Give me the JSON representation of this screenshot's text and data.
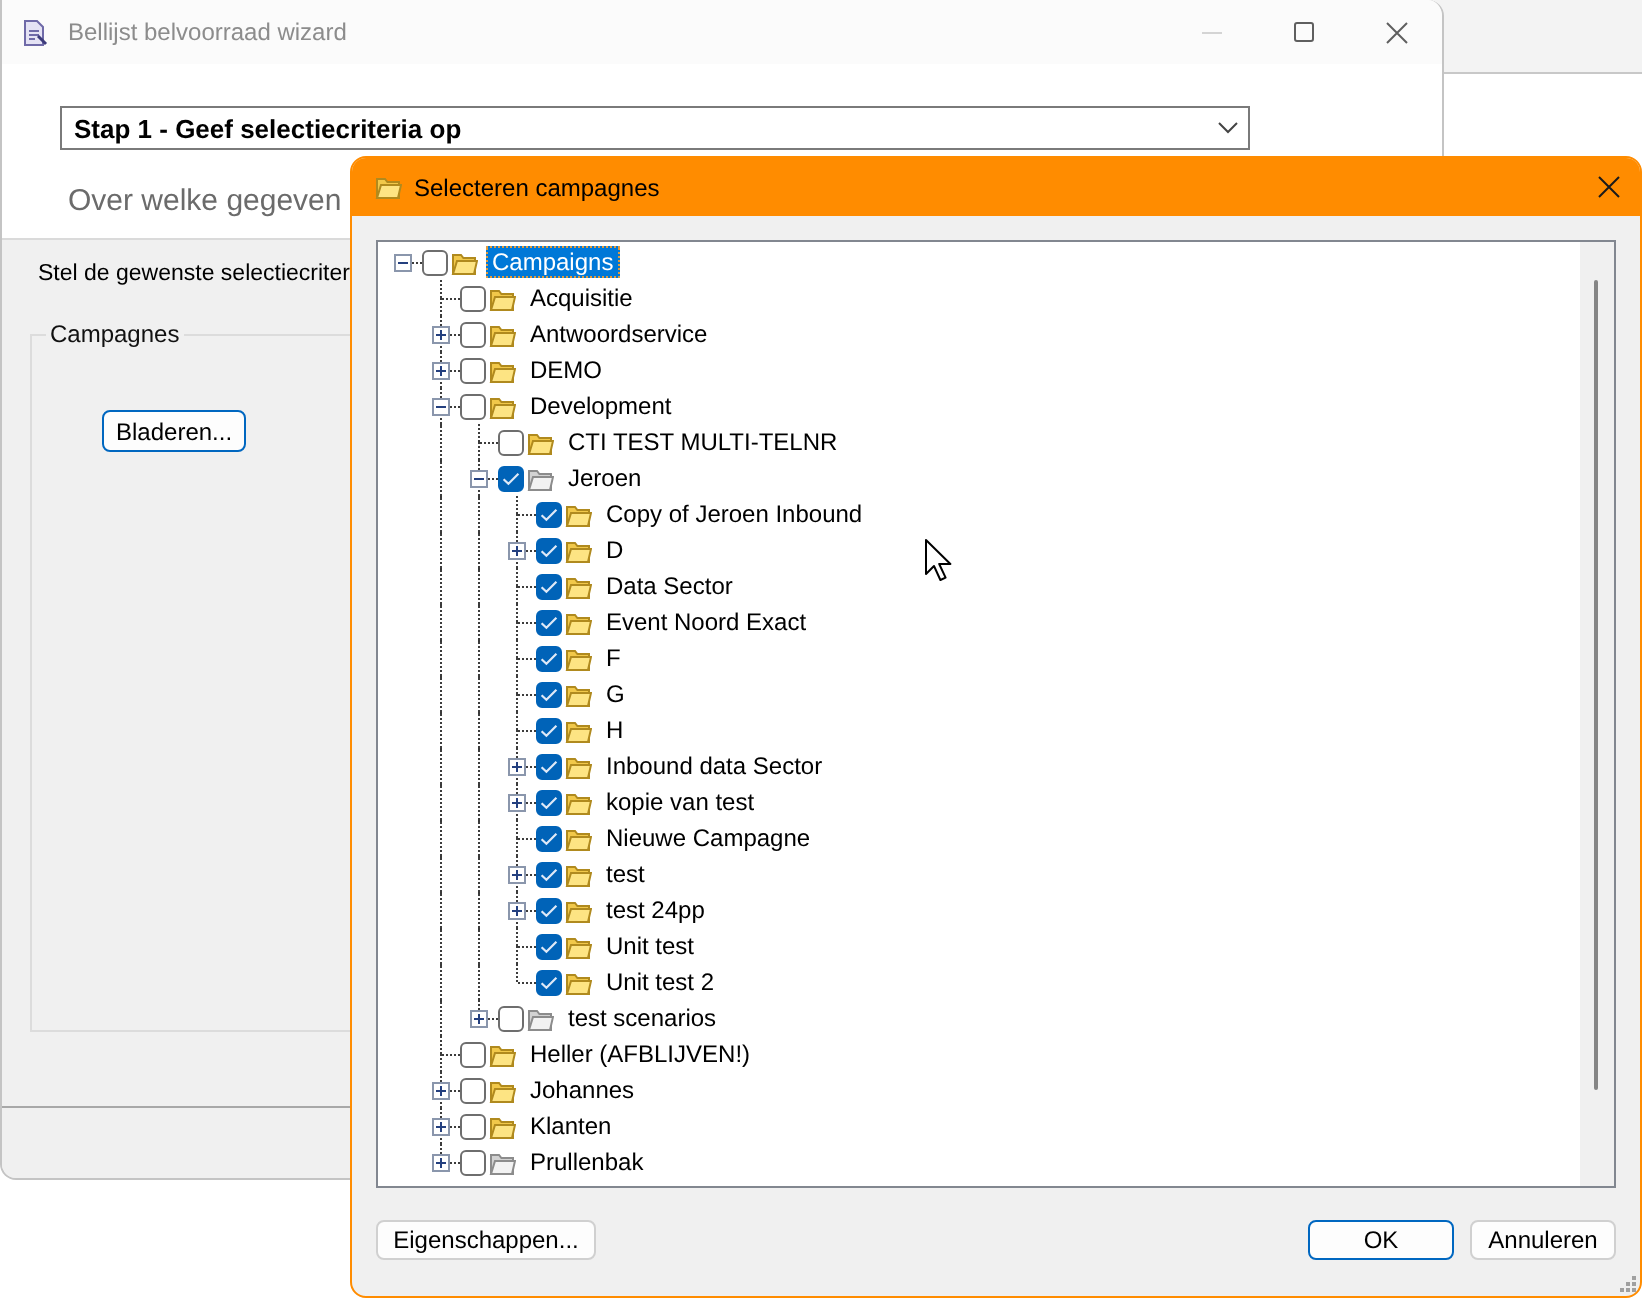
{
  "wizard": {
    "title": "Bellijst belvoorraad wizard",
    "window_controls": [
      {
        "kind": "minimize",
        "disabled": true
      },
      {
        "kind": "maximize",
        "disabled": false
      },
      {
        "kind": "close",
        "disabled": false
      }
    ],
    "step_select": {
      "value": "Stap 1 - Geef selectiecriteria op"
    },
    "heading": "Over welke gegeven",
    "instruction": "Stel de gewenste selectiecriter",
    "group": {
      "label": "Campagnes",
      "browse_button": {
        "label": "Bladeren...",
        "default": true
      }
    }
  },
  "dialog": {
    "title": "Selecteren campagnes",
    "tree": [
      {
        "label": "Campaigns",
        "checked": false,
        "selected": true,
        "expandable": true,
        "expanded": true,
        "greyed": false,
        "children": [
          {
            "label": "Acquisitie",
            "checked": false,
            "selected": false,
            "expandable": false,
            "expanded": false,
            "greyed": false
          },
          {
            "label": "Antwoordservice",
            "checked": false,
            "selected": false,
            "expandable": true,
            "expanded": false,
            "greyed": false
          },
          {
            "label": "DEMO",
            "checked": false,
            "selected": false,
            "expandable": true,
            "expanded": false,
            "greyed": false
          },
          {
            "label": "Development",
            "checked": false,
            "selected": false,
            "expandable": true,
            "expanded": true,
            "greyed": false,
            "children": [
              {
                "label": "CTI TEST MULTI-TELNR",
                "checked": false,
                "selected": false,
                "expandable": false,
                "expanded": false,
                "greyed": false
              },
              {
                "label": "Jeroen",
                "checked": true,
                "selected": false,
                "expandable": true,
                "expanded": true,
                "greyed": true,
                "children": [
                  {
                    "label": "Copy of Jeroen Inbound",
                    "checked": true,
                    "selected": false,
                    "expandable": false,
                    "expanded": false,
                    "greyed": false
                  },
                  {
                    "label": "D",
                    "checked": true,
                    "selected": false,
                    "expandable": true,
                    "expanded": false,
                    "greyed": false
                  },
                  {
                    "label": "Data Sector",
                    "checked": true,
                    "selected": false,
                    "expandable": false,
                    "expanded": false,
                    "greyed": false
                  },
                  {
                    "label": "Event Noord Exact",
                    "checked": true,
                    "selected": false,
                    "expandable": false,
                    "expanded": false,
                    "greyed": false
                  },
                  {
                    "label": "F",
                    "checked": true,
                    "selected": false,
                    "expandable": false,
                    "expanded": false,
                    "greyed": false
                  },
                  {
                    "label": "G",
                    "checked": true,
                    "selected": false,
                    "expandable": false,
                    "expanded": false,
                    "greyed": false
                  },
                  {
                    "label": "H",
                    "checked": true,
                    "selected": false,
                    "expandable": false,
                    "expanded": false,
                    "greyed": false
                  },
                  {
                    "label": "Inbound data Sector",
                    "checked": true,
                    "selected": false,
                    "expandable": true,
                    "expanded": false,
                    "greyed": false
                  },
                  {
                    "label": "kopie van test",
                    "checked": true,
                    "selected": false,
                    "expandable": true,
                    "expanded": false,
                    "greyed": false
                  },
                  {
                    "label": "Nieuwe Campagne",
                    "checked": true,
                    "selected": false,
                    "expandable": false,
                    "expanded": false,
                    "greyed": false
                  },
                  {
                    "label": "test",
                    "checked": true,
                    "selected": false,
                    "expandable": true,
                    "expanded": false,
                    "greyed": false
                  },
                  {
                    "label": "test 24pp",
                    "checked": true,
                    "selected": false,
                    "expandable": true,
                    "expanded": false,
                    "greyed": false
                  },
                  {
                    "label": "Unit test",
                    "checked": true,
                    "selected": false,
                    "expandable": false,
                    "expanded": false,
                    "greyed": false
                  },
                  {
                    "label": "Unit test 2",
                    "checked": true,
                    "selected": false,
                    "expandable": false,
                    "expanded": false,
                    "greyed": false
                  }
                ]
              },
              {
                "label": "test scenarios",
                "checked": false,
                "selected": false,
                "expandable": true,
                "expanded": false,
                "greyed": true
              }
            ]
          },
          {
            "label": "Heller (AFBLIJVEN!)",
            "checked": false,
            "selected": false,
            "expandable": false,
            "expanded": false,
            "greyed": false
          },
          {
            "label": "Johannes",
            "checked": false,
            "selected": false,
            "expandable": true,
            "expanded": false,
            "greyed": false
          },
          {
            "label": "Klanten",
            "checked": false,
            "selected": false,
            "expandable": true,
            "expanded": false,
            "greyed": false
          },
          {
            "label": "Prullenbak",
            "checked": false,
            "selected": false,
            "expandable": true,
            "expanded": false,
            "greyed": true
          }
        ]
      }
    ],
    "left_buttons": [
      {
        "label": "Eigenschappen...",
        "default": false
      }
    ],
    "right_buttons": [
      {
        "label": "OK",
        "default": true
      },
      {
        "label": "Annuleren",
        "default": false
      }
    ]
  }
}
